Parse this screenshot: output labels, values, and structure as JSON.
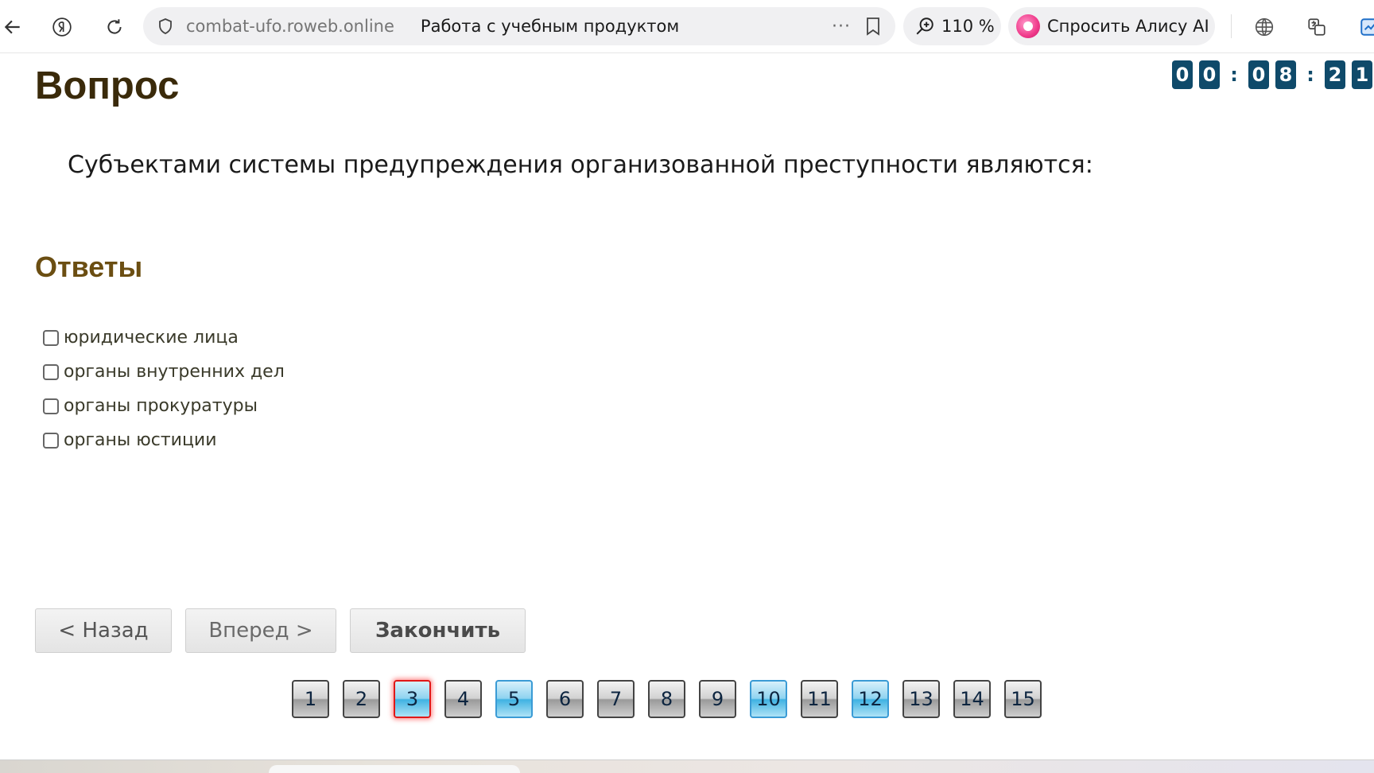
{
  "browser": {
    "domain": "combat-ufo.roweb.online",
    "page_title": "Работа с учебным продуктом",
    "more": "···",
    "zoom": "110 %",
    "alice_label": "Спросить Алису AI",
    "icons": [
      "back-arrow-icon",
      "yandex-icon",
      "reload-icon",
      "shield-icon",
      "bookmark-icon",
      "zoom-icon",
      "alice-icon",
      "globe-icon",
      "translate-icon",
      "extension-icon"
    ]
  },
  "timer": {
    "digits": [
      "0",
      "0",
      ":",
      "0",
      "8",
      ":",
      "2",
      "1"
    ]
  },
  "question": {
    "heading": "Вопрос",
    "text": "Субъектами системы предупреждения организованной преступности являются:"
  },
  "answers": {
    "heading": "Ответы",
    "items": [
      {
        "label": "юридические лица",
        "checked": false
      },
      {
        "label": "органы внутренних дел",
        "checked": false
      },
      {
        "label": "органы прокуратуры",
        "checked": false
      },
      {
        "label": "органы юстиции",
        "checked": false
      }
    ]
  },
  "nav": {
    "back": "< Назад",
    "next": "Вперед >",
    "finish": "Закончить"
  },
  "question_nav": {
    "current": 3,
    "answered": [
      3,
      5,
      10,
      12
    ],
    "items": [
      "1",
      "2",
      "3",
      "4",
      "5",
      "6",
      "7",
      "8",
      "9",
      "10",
      "11",
      "12",
      "13",
      "14",
      "15"
    ]
  },
  "colors": {
    "timer_bg": "#0f4a6a",
    "heading": "#3a2a0a",
    "answers_heading": "#6b4e12",
    "answered": "#3fb2e2",
    "current_border": "#e01818"
  }
}
